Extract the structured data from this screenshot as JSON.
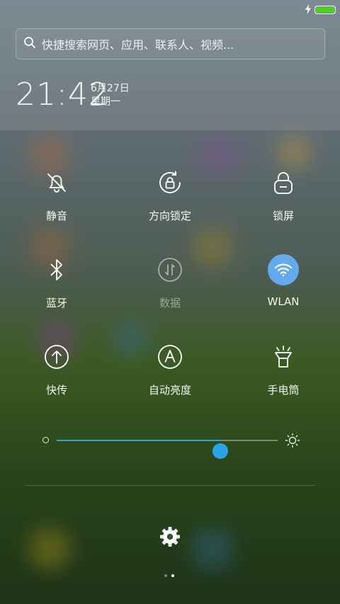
{
  "search": {
    "placeholder": "快捷搜索网页、应用、联系人、视频..."
  },
  "clock": {
    "time": "21:42",
    "date": "6月27日",
    "weekday": "星期一"
  },
  "toggles": [
    {
      "label": "静音",
      "icon": "mute-bell-icon",
      "active": false
    },
    {
      "label": "方向锁定",
      "icon": "rotation-lock-icon",
      "active": false
    },
    {
      "label": "锁屏",
      "icon": "lock-icon",
      "active": false
    },
    {
      "label": "蓝牙",
      "icon": "bluetooth-icon",
      "active": false
    },
    {
      "label": "数据",
      "icon": "mobile-data-icon",
      "active": false,
      "disabled": true
    },
    {
      "label": "WLAN",
      "icon": "wifi-icon",
      "active": true
    },
    {
      "label": "快传",
      "icon": "quick-transfer-icon",
      "active": false
    },
    {
      "label": "自动亮度",
      "icon": "auto-brightness-icon",
      "active": false
    },
    {
      "label": "手电筒",
      "icon": "flashlight-icon",
      "active": false
    }
  ],
  "brightness": {
    "level": 0.74
  },
  "colors": {
    "accent": "#29a4e6",
    "wifi_active": "#62a9f0",
    "battery": "#4cd11d"
  },
  "pager": {
    "pages": 2,
    "current": 1
  }
}
